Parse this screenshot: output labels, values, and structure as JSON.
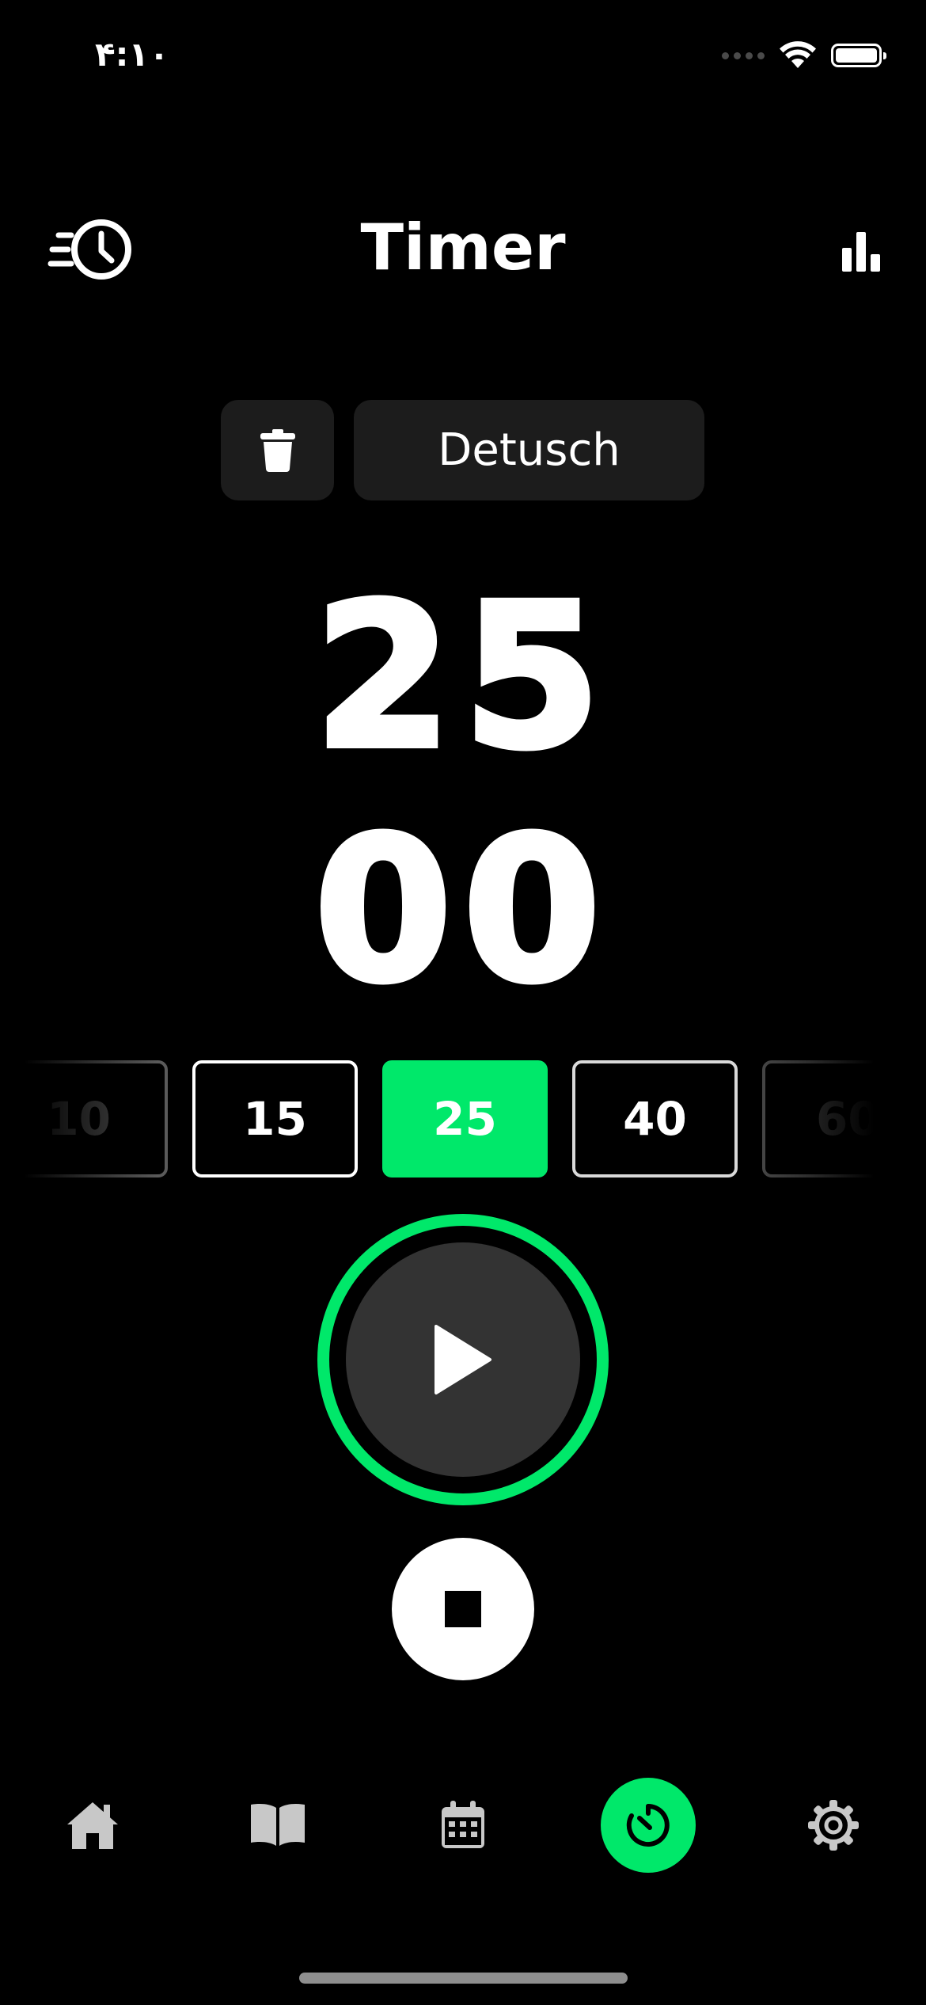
{
  "status_bar": {
    "time": "۴:۱۰"
  },
  "header": {
    "title": "Timer"
  },
  "task": {
    "label": "Detusch"
  },
  "timer": {
    "minutes": "25",
    "seconds": "00"
  },
  "presets": {
    "items": [
      "10",
      "15",
      "25",
      "40",
      "60"
    ],
    "selected": "25"
  },
  "colors": {
    "accent": "#00e86a",
    "background": "#000000",
    "surface": "#1c1c1c",
    "play_fill": "#333333",
    "icon_gray": "#c8c8c8"
  },
  "icons": {
    "header_left": "history-clock-icon",
    "header_right": "bar-chart-icon",
    "delete": "trash-icon",
    "play": "play-icon",
    "stop": "stop-icon",
    "tabs": [
      "home-icon",
      "book-icon",
      "calendar-icon",
      "timer-icon",
      "gear-icon"
    ]
  },
  "tabbar": {
    "active": "timer"
  }
}
